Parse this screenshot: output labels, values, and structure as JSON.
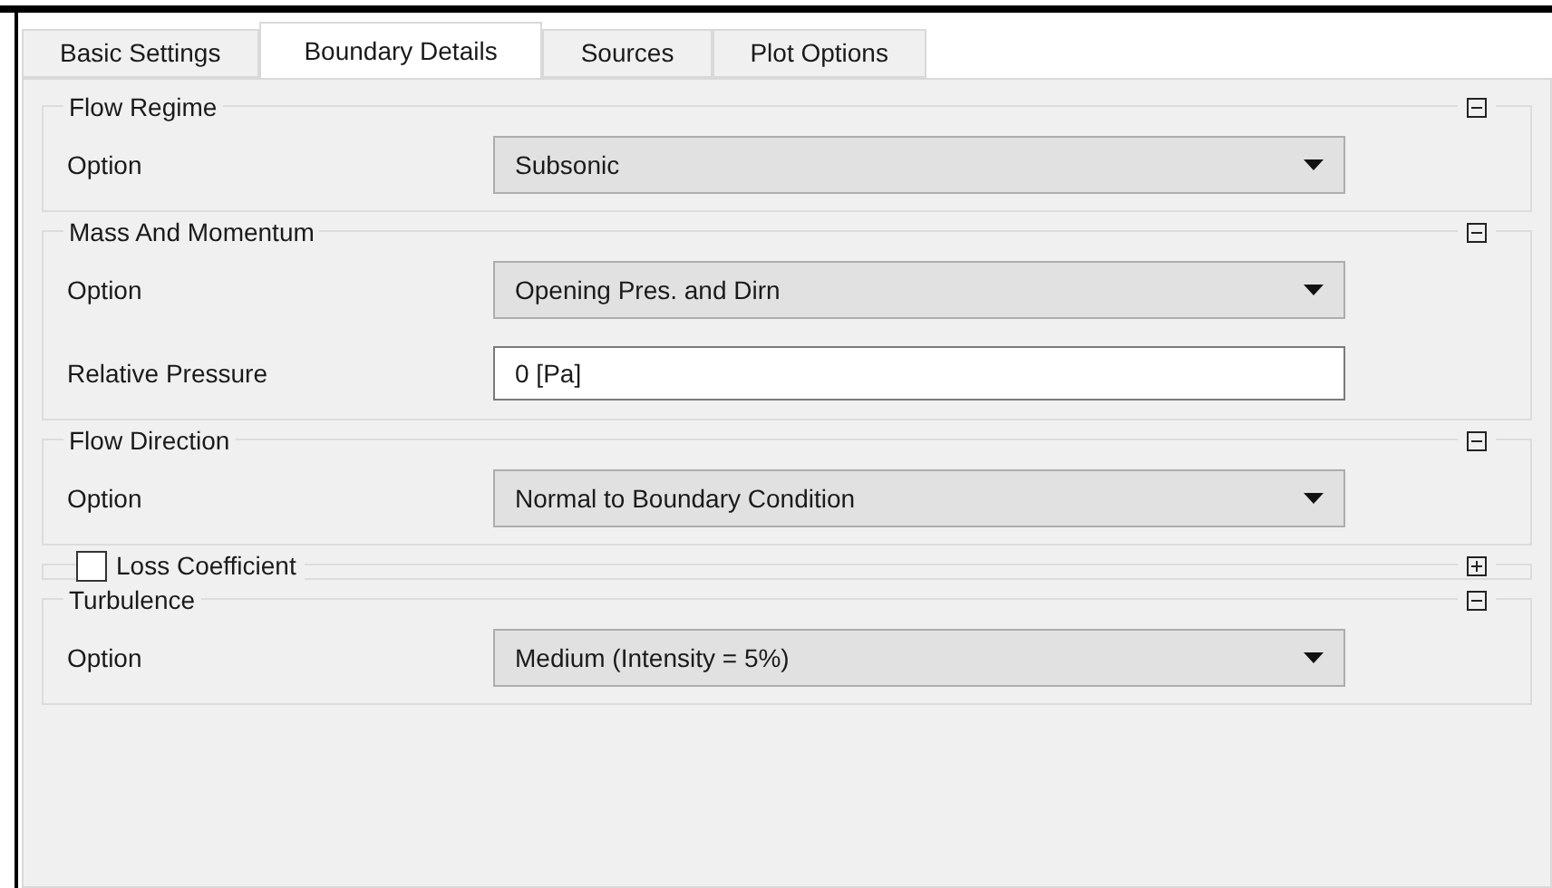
{
  "tabs": [
    {
      "label": "Basic Settings",
      "selected": false
    },
    {
      "label": "Boundary Details",
      "selected": true
    },
    {
      "label": "Sources",
      "selected": false
    },
    {
      "label": "Plot Options",
      "selected": false
    }
  ],
  "groups": [
    {
      "title": "Flow Regime",
      "expanded": true,
      "rows": [
        {
          "kind": "dropdown",
          "label": "Option",
          "value": "Subsonic"
        }
      ]
    },
    {
      "title": "Mass And Momentum",
      "expanded": true,
      "rows": [
        {
          "kind": "dropdown",
          "label": "Option",
          "value": "Opening Pres. and Dirn"
        },
        {
          "kind": "text",
          "label": "Relative Pressure",
          "value": "0 [Pa]"
        }
      ]
    },
    {
      "title": "Flow Direction",
      "expanded": true,
      "rows": [
        {
          "kind": "dropdown",
          "label": "Option",
          "value": "Normal to Boundary Condition"
        }
      ]
    },
    {
      "title": "Loss Coefficient",
      "expanded": false,
      "checked": false
    },
    {
      "title": "Turbulence",
      "expanded": true,
      "rows": [
        {
          "kind": "dropdown",
          "label": "Option",
          "value": "Medium (Intensity = 5%)"
        }
      ]
    }
  ]
}
